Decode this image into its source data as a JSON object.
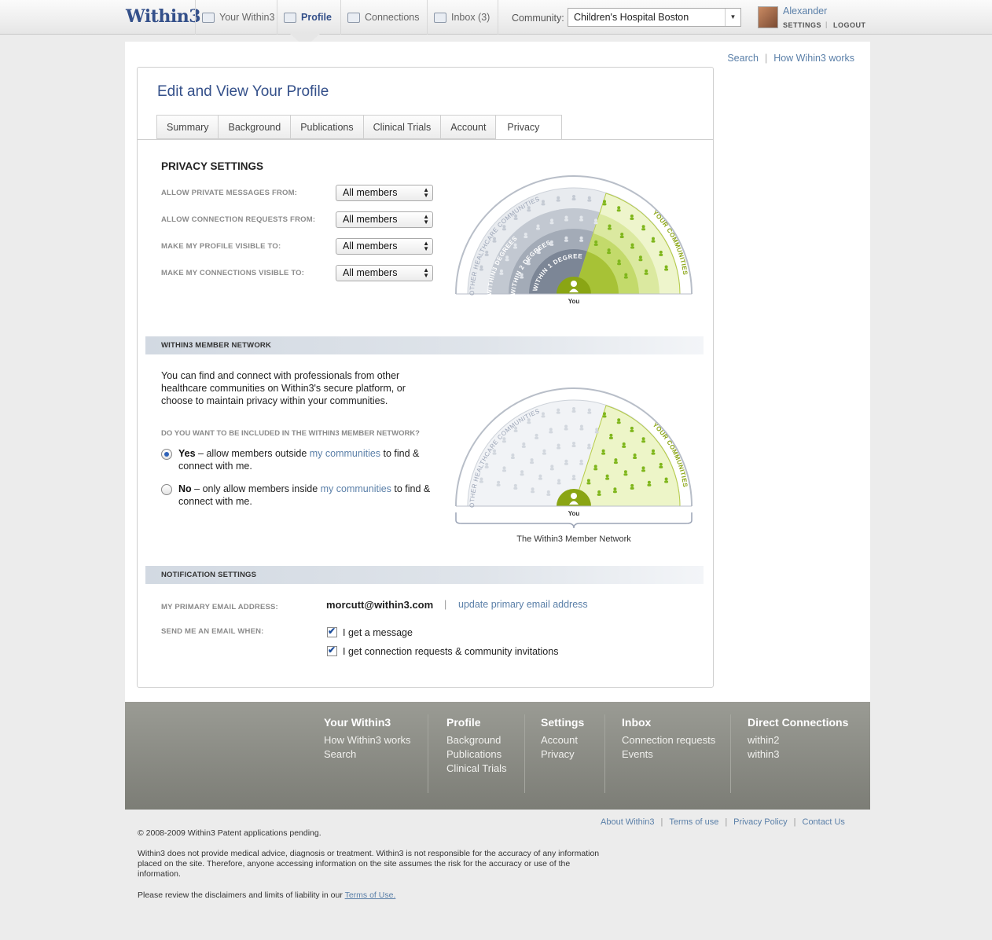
{
  "header": {
    "logo": "Within3",
    "nav": [
      {
        "label": "Your Within3"
      },
      {
        "label": "Profile"
      },
      {
        "label": "Connections"
      },
      {
        "label": "Inbox (3)"
      }
    ],
    "community_label": "Community:",
    "community_value": "Children's Hospital Boston",
    "user_name": "Alexander",
    "settings": "SETTINGS",
    "separator": "|",
    "logout": "LOGOUT"
  },
  "util_links": {
    "search": "Search",
    "sep": "|",
    "how": "How Wihin3 works"
  },
  "profile": {
    "title": "Edit and View Your Profile",
    "tabs": [
      "Summary",
      "Background",
      "Publications",
      "Clinical Trials",
      "Account",
      "Privacy"
    ]
  },
  "privacy": {
    "title": "PRIVACY SETTINGS",
    "fields": [
      {
        "label": "ALLOW PRIVATE MESSAGES FROM:",
        "value": "All members"
      },
      {
        "label": "ALLOW CONNECTION REQUESTS FROM:",
        "value": "All members"
      },
      {
        "label": "MAKE MY PROFILE VISIBLE TO:",
        "value": "All members"
      },
      {
        "label": "MAKE MY CONNECTIONS VISIBLE TO:",
        "value": "All members"
      }
    ],
    "diagram": {
      "outer_label": "OTHER HEALTHCARE COMMUNITIES",
      "right_label": "YOUR COMMUNITIES",
      "rings": [
        "WITHIN3 DEGREES",
        "WITHIN 2 DEGREES",
        "WITHIN 1 DEGREE"
      ],
      "center": "You"
    }
  },
  "network": {
    "band": "WITHIN3 MEMBER NETWORK",
    "description": "You can find and connect with professionals from other healthcare communities on Within3's secure platform, or choose to maintain privacy within your communities.",
    "question": "DO YOU WANT TO BE INCLUDED IN THE WITHIN3 MEMBER NETWORK?",
    "yes": {
      "strong": "Yes",
      "pre": " – allow members outside ",
      "link": "my communities",
      "post": " to find & connect with me."
    },
    "no": {
      "strong": "No",
      "pre": " – only allow members inside ",
      "link": "my communities",
      "post": " to find & connect with me."
    },
    "diagram": {
      "outer_label": "OTHER HEALTHCARE COMMUNITIES",
      "right_label": "YOUR COMMUNITIES",
      "center": "You",
      "caption": "The Within3 Member Network"
    }
  },
  "notifications": {
    "band": "NOTIFICATION SETTINGS",
    "email_label": "MY PRIMARY EMAIL ADDRESS:",
    "email": "morcutt@within3.com",
    "sep": "|",
    "update_link": "update primary email address",
    "send_label": "SEND ME AN EMAIL WHEN:",
    "options": [
      {
        "label": "I get a message",
        "checked": true
      },
      {
        "label": "I get connection requests & community invitations",
        "checked": true
      }
    ]
  },
  "footer": {
    "columns": [
      {
        "title": "Your Within3",
        "links": [
          "How Within3 works",
          "Search"
        ]
      },
      {
        "title": "Profile",
        "links": [
          "Background",
          "Publications",
          "Clinical Trials"
        ]
      },
      {
        "title": "Settings",
        "links": [
          "Account",
          "Privacy"
        ]
      },
      {
        "title": "Inbox",
        "links": [
          "Connection requests",
          "Events"
        ]
      },
      {
        "title": "Direct Connections",
        "links": [
          "within2",
          "within3"
        ]
      }
    ],
    "bottom_links": [
      "About Within3",
      "Terms of use",
      "Privacy Policy",
      "Contact Us"
    ],
    "copyright": "© 2008-2009 Within3 Patent applications pending.",
    "disclaimer": "Within3 does not provide medical advice, diagnosis or treatment. Within3 is not responsible for the accuracy of any information placed on the site. Therefore, anyone accessing information on the site assumes the risk for the accuracy or use of the information.",
    "review_text": "Please review the disclaimers and limits of liability in our",
    "review_link": "Terms of Use."
  },
  "colors": {
    "brand": "#34508a",
    "link": "#5a7fa8",
    "green": "#9ab81a",
    "slate": "#7c8696"
  },
  "icons": [
    "your-within3-icon",
    "profile-icon",
    "connections-icon",
    "inbox-icon",
    "dropdown-arrow-icon",
    "person-icon",
    "checkmark-icon"
  ]
}
